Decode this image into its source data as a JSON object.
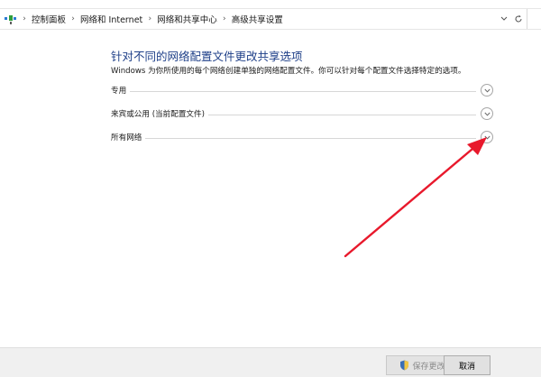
{
  "address_bar": {
    "breadcrumbs": [
      "控制面板",
      "网络和 Internet",
      "网络和共享中心",
      "高级共享设置"
    ]
  },
  "main": {
    "title": "针对不同的网络配置文件更改共享选项",
    "description": "Windows 为你所使用的每个网络创建单独的网络配置文件。你可以针对每个配置文件选择特定的选项。",
    "profiles": [
      {
        "label": "专用",
        "expanded": false
      },
      {
        "label": "来宾或公用 (当前配置文件)",
        "expanded": false
      },
      {
        "label": "所有网络",
        "expanded": false
      }
    ]
  },
  "footer": {
    "save_label": "保存更改",
    "cancel_label": "取消"
  },
  "colors": {
    "title": "#1e3f88",
    "annotation_arrow": "#e8192c",
    "footer_bg": "#f0f0f0"
  }
}
